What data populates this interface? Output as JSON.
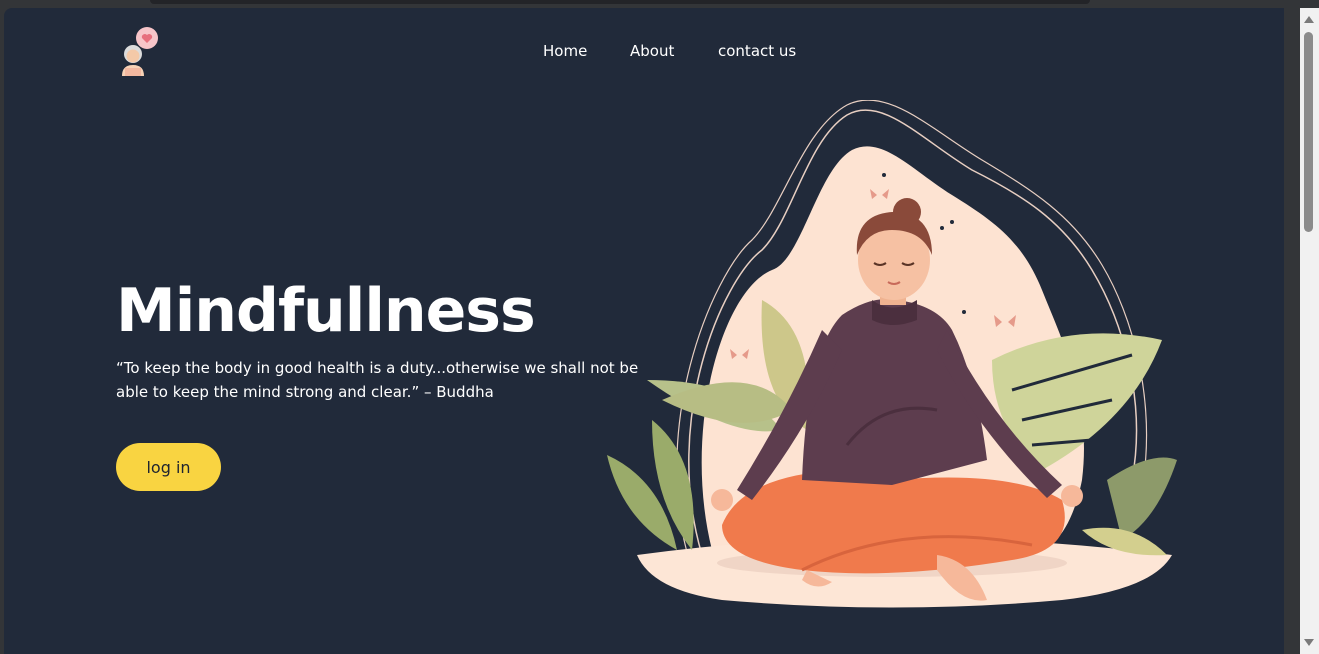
{
  "header": {
    "logo_icon": "meditation-avatar-heart-icon",
    "nav": [
      {
        "label": "Home"
      },
      {
        "label": "About"
      },
      {
        "label": "contact us"
      }
    ]
  },
  "hero": {
    "title": "Mindfullness",
    "quote": "“To keep the body in good health is a duty...otherwise we shall not be able to keep the mind strong and clear.” – Buddha",
    "login_label": "log in",
    "illustration_icon": "meditating-woman-illustration"
  },
  "colors": {
    "background": "#212a3a",
    "accent_button": "#f9d441",
    "text": "#ffffff"
  }
}
